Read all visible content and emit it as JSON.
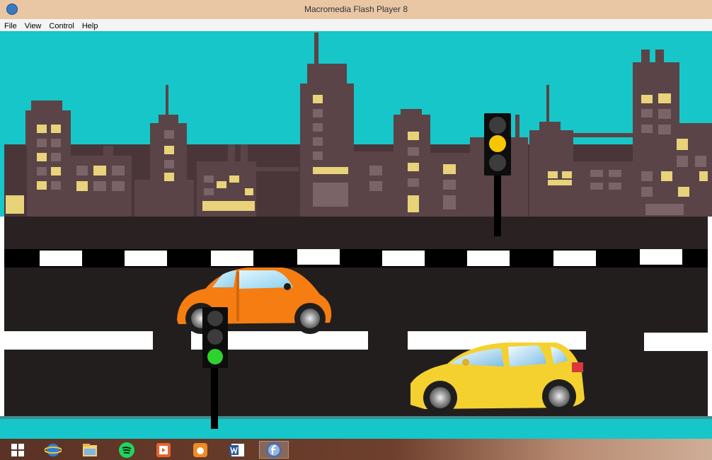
{
  "window": {
    "title": "Macromedia Flash Player 8"
  },
  "menu": {
    "file": "File",
    "view": "View",
    "control": "Control",
    "help": "Help"
  },
  "taskbar": {
    "apps": [
      "start-icon",
      "internet-explorer-icon",
      "file-explorer-icon",
      "spotify-icon",
      "media-player-icon",
      "uc-browser-icon",
      "word-icon",
      "flash-player-icon"
    ]
  },
  "colors": {
    "sky": "#16c6c8",
    "building": "#5a4447",
    "window_lit": "#e8d27a",
    "road": "#231e1e",
    "lane": "#ffffff",
    "orange_car": "#f57d12",
    "yellow_car": "#f5d130",
    "light_green": "#2ed22c",
    "light_yellow": "#f7c600"
  }
}
